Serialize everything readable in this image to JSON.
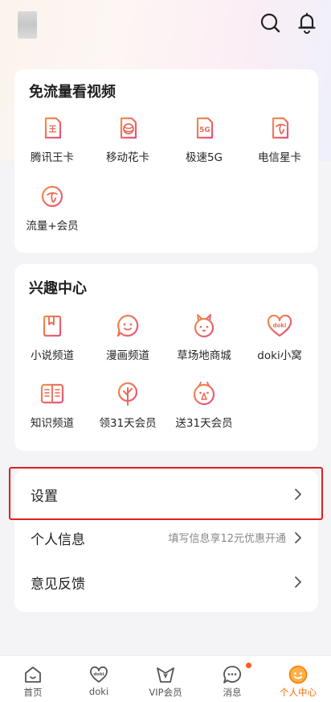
{
  "colors": {
    "accent": "#ff6a00",
    "icon_gradient_start": "#f1894a",
    "icon_gradient_end": "#e7547a",
    "highlight_border": "#e02020"
  },
  "topbar": {
    "icons": [
      "search-icon",
      "bell-icon"
    ]
  },
  "data_free": {
    "title": "免流量看视频",
    "items": [
      {
        "label": "腾讯王卡",
        "icon": "sim-card-wang-icon",
        "glyph": "王"
      },
      {
        "label": "移动花卡",
        "icon": "sim-card-flower-icon"
      },
      {
        "label": "极速5G",
        "icon": "sim-card-5g-icon",
        "glyph": "5G"
      },
      {
        "label": "电信星卡",
        "icon": "sim-card-telecom-icon"
      },
      {
        "label": "流量+会员",
        "icon": "telecom-circle-icon"
      }
    ]
  },
  "interest": {
    "title": "兴趣中心",
    "items": [
      {
        "label": "小说频道",
        "icon": "book-icon"
      },
      {
        "label": "漫画频道",
        "icon": "chat-face-icon"
      },
      {
        "label": "草场地商城",
        "icon": "rabbit-icon"
      },
      {
        "label": "doki小窝",
        "icon": "doki-heart-icon",
        "glyph": "doki"
      },
      {
        "label": "知识频道",
        "icon": "open-book-icon"
      },
      {
        "label": "领31天会员",
        "icon": "tree-icon"
      },
      {
        "label": "送31天会员",
        "icon": "gift-face-icon"
      }
    ]
  },
  "menu": [
    {
      "title": "设置",
      "subtitle": ""
    },
    {
      "title": "个人信息",
      "subtitle": "填写信息享12元优惠开通"
    },
    {
      "title": "意见反馈",
      "subtitle": ""
    }
  ],
  "tabbar": {
    "tabs": [
      {
        "label": "首页",
        "icon": "home-icon"
      },
      {
        "label": "doki",
        "icon": "doki-tab-icon"
      },
      {
        "label": "VIP会员",
        "icon": "vip-bowtie-icon"
      },
      {
        "label": "消息",
        "icon": "message-icon",
        "badge": true
      },
      {
        "label": "个人中心",
        "icon": "profile-face-icon",
        "active": true
      }
    ]
  }
}
